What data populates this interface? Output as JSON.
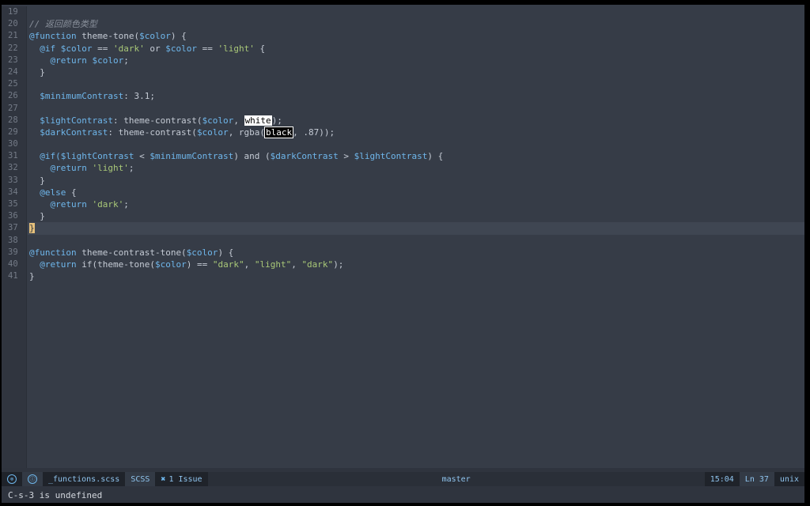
{
  "editor": {
    "line_numbers": [
      "19",
      "20",
      "21",
      "22",
      "23",
      "24",
      "25",
      "26",
      "27",
      "28",
      "29",
      "30",
      "31",
      "32",
      "33",
      "34",
      "35",
      "36",
      "37",
      "38",
      "39",
      "40",
      "41"
    ],
    "current_line": "37",
    "tokens": {
      "l20": "// 返回颜色类型",
      "l21_kw": "@function",
      "l21_fn": " theme-tone(",
      "l21_var": "$color",
      "l21_end": ") {",
      "l22_kw": "@if",
      "l22_var1": "$color",
      "l22_op1": " == ",
      "l22_str1": "'dark'",
      "l22_or": " or ",
      "l22_var2": "$color",
      "l22_op2": " == ",
      "l22_str2": "'light'",
      "l22_end": " {",
      "l23_kw": "@return",
      "l23_var": "$color",
      "l23_end": ";",
      "close": "}",
      "l26_var": "$minimumContrast",
      "l26_rest": ": 3.1;",
      "l28_var": "$lightContrast",
      "l28_fn": ": theme-contrast(",
      "l28_var2": "$color",
      "l28_comma": ", ",
      "l28_hl": "white",
      "l28_end": ");",
      "l29_var": "$darkContrast",
      "l29_fn": ": theme-contrast(",
      "l29_var2": "$color",
      "l29_mid": ", rgba(",
      "l29_hl": "black",
      "l29_end": ", .87));",
      "l31_kw": "@if(",
      "l31_var1": "$lightContrast",
      "l31_lt": " < ",
      "l31_var2": "$minimumContrast",
      "l31_and": ") and (",
      "l31_var3": "$darkContrast",
      "l31_gt": " > ",
      "l31_var4": "$lightContrast",
      "l31_end": ") {",
      "l32_kw": "@return",
      "l32_str": "'light'",
      "semicolon": ";",
      "l34_kw": "@else",
      "l34_end": " {",
      "l35_kw": "@return",
      "l35_str": "'dark'",
      "l39_kw": "@function",
      "l39_fn": " theme-contrast-tone(",
      "l39_var": "$color",
      "l39_end": ") {",
      "l40_kw": "@return",
      "l40_fn": " if(theme-tone(",
      "l40_var": "$color",
      "l40_eq": ") == ",
      "l40_s1": "\"dark\"",
      "l40_c1": ", ",
      "l40_s2": "\"light\"",
      "l40_c2": ", ",
      "l40_s3": "\"dark\"",
      "l40_end": ");"
    }
  },
  "statusbar": {
    "file_name": "_functions.scss",
    "mode": "SCSS",
    "issue_symbol": "✖",
    "issues": "1 Issue",
    "branch": "master",
    "time": "15:04",
    "line_pos": "Ln 37",
    "encoding": "unix",
    "icon_left": "⊗",
    "icon_info": "ⓘ"
  },
  "minibuffer": {
    "message": "C-s-3 is undefined"
  },
  "colors": {
    "background": "#363c47",
    "keyword": "#6fb7ec",
    "string": "#a9c878",
    "comment": "#8a919c"
  }
}
